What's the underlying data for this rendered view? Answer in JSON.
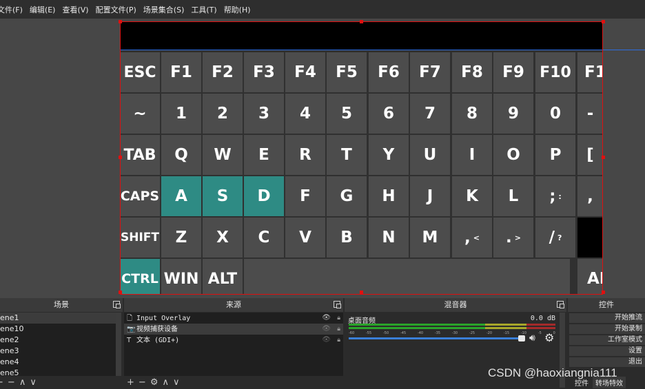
{
  "menu": [
    "文件(F)",
    "编辑(E)",
    "查看(V)",
    "配置文件(P)",
    "场景集合(S)",
    "工具(T)",
    "帮助(H)"
  ],
  "keyboard": {
    "active_color": "#2e8b84",
    "key_color": "#4c4c4c",
    "rows": [
      [
        "ESC",
        "F1",
        "F2",
        "F3",
        "F4",
        "F5",
        "F6",
        "F7",
        "F8",
        "F9",
        "F10",
        "F1"
      ],
      [
        "~",
        "1",
        "2",
        "3",
        "4",
        "5",
        "6",
        "7",
        "8",
        "9",
        "0",
        "-"
      ],
      [
        "TAB",
        "Q",
        "W",
        "E",
        "R",
        "T",
        "Y",
        "U",
        "I",
        "O",
        "P",
        "["
      ],
      [
        "CAPS",
        "A",
        "S",
        "D",
        "F",
        "G",
        "H",
        "J",
        "K",
        "L",
        ";",
        ","
      ],
      [
        "SHIFT",
        "Z",
        "X",
        "C",
        "V",
        "B",
        "N",
        "M",
        ",",
        ".",
        "/"
      ],
      [
        "CTRL",
        "WIN",
        "ALT",
        "AL"
      ]
    ],
    "sublabels": {
      "row3_10": ":",
      "row4_8": "<",
      "row4_9": ">",
      "row4_10": "?"
    },
    "active_keys": [
      "A",
      "S",
      "D",
      "CTRL"
    ]
  },
  "scenes": {
    "title": "场景",
    "items": [
      "ene1",
      "ene10",
      "ene2",
      "ene3",
      "ene4",
      "ene5"
    ],
    "toolbar": [
      "+",
      "−",
      "∧",
      "∨"
    ]
  },
  "sources": {
    "title": "来源",
    "items": [
      {
        "icon": "🗋",
        "name": "Input Overlay",
        "visible": true
      },
      {
        "icon": "📷",
        "name": "视频捕获设备",
        "visible": false
      },
      {
        "icon": "T",
        "name": "文本 (GDI+)",
        "visible": false
      }
    ],
    "toolbar": [
      "+",
      "−",
      "⚙",
      "∧",
      "∨"
    ]
  },
  "mixer": {
    "title": "混音器",
    "channel": "桌面音频",
    "db": "0.0 dB",
    "ticks": [
      "-60",
      "-55",
      "-50",
      "-45",
      "-40",
      "-35",
      "-30",
      "-25",
      "-20",
      "-15",
      "-10",
      "-5",
      "0"
    ]
  },
  "controls": {
    "title": "控件",
    "buttons": [
      "开始推流",
      "开始录制",
      "工作室模式",
      "设置",
      "退出"
    ],
    "tabs": [
      "控件",
      "转场特效"
    ]
  },
  "watermark": "CSDN @haoxiangnia111"
}
